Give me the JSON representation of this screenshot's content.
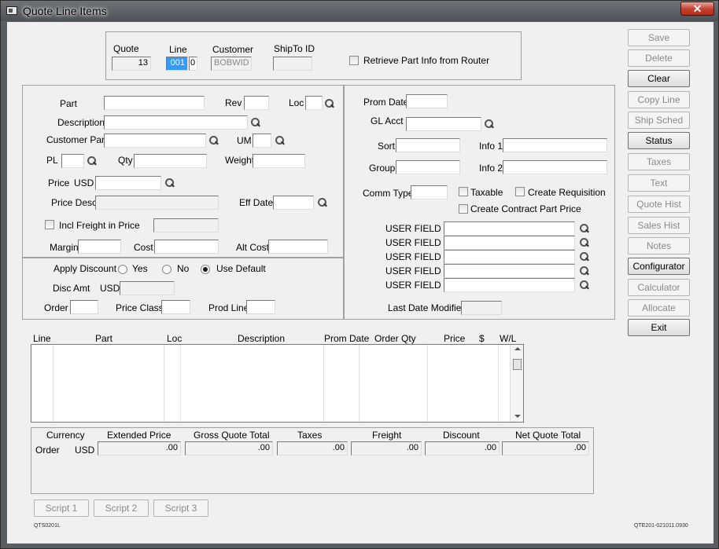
{
  "window": {
    "title": "Quote Line Items",
    "close_label": "✕"
  },
  "header": {
    "quote_label": "Quote",
    "quote_value": "13",
    "line_label": "Line",
    "line_value": "001",
    "line_sub_value": "0",
    "customer_label": "Customer",
    "customer_value": "BOBWID",
    "shipto_label": "ShipTo ID",
    "shipto_value": "",
    "retrieve_label": "Retrieve Part Info from Router"
  },
  "left": {
    "part_label": "Part",
    "rev_label": "Rev",
    "loc_label": "Loc",
    "description_label": "Description",
    "customer_part_label": "Customer Part",
    "um_label": "UM",
    "pl_label": "PL",
    "qty_label": "Qty",
    "weight_label": "Weight",
    "price_label": "Price",
    "price_currency": "USD",
    "price_desc_label": "Price Desc",
    "eff_date_label": "Eff Date",
    "incl_freight_label": "Incl Freight in Price",
    "margin_label": "Margin",
    "cost_label": "Cost",
    "alt_cost_label": "Alt Cost"
  },
  "discount": {
    "apply_label": "Apply Discount",
    "yes_label": "Yes",
    "no_label": "No",
    "default_label": "Use Default",
    "disc_amt_label": "Disc Amt",
    "disc_currency": "USD",
    "order_label": "Order",
    "price_class_label": "Price Class",
    "prod_line_label": "Prod Line"
  },
  "right": {
    "prom_date_label": "Prom Date",
    "gl_acct_label": "GL Acct",
    "sort_label": "Sort",
    "info1_label": "Info 1",
    "group_label": "Group",
    "info2_label": "Info 2",
    "comm_type_label": "Comm Type",
    "taxable_label": "Taxable",
    "create_req_label": "Create Requisition",
    "create_contract_label": "Create Contract Part Price",
    "user_fields": [
      "USER FIELD 1",
      "USER FIELD 2",
      "USER FIELD 3",
      "USER FIELD 4",
      "USER FIELD 5"
    ],
    "last_modified_label": "Last Date Modified"
  },
  "grid": {
    "columns": [
      "Line",
      "Part",
      "Loc",
      "Description",
      "Prom Date",
      "Order Qty",
      "Price",
      "$",
      "W/L"
    ]
  },
  "totals": {
    "currency_label": "Currency",
    "extended_label": "Extended Price",
    "gross_label": "Gross Quote Total",
    "taxes_label": "Taxes",
    "freight_label": "Freight",
    "discount_label": "Discount",
    "net_label": "Net Quote Total",
    "row_label": "Order",
    "row_currency": "USD",
    "extended_value": ".00",
    "gross_value": ".00",
    "taxes_value": ".00",
    "freight_value": ".00",
    "discount_value": ".00",
    "net_value": ".00"
  },
  "scripts": [
    "Script 1",
    "Script 2",
    "Script 3"
  ],
  "buttons": [
    {
      "label": "Save",
      "enabled": false
    },
    {
      "label": "Delete",
      "enabled": false
    },
    {
      "label": "Clear",
      "enabled": true
    },
    {
      "label": "Copy Line",
      "enabled": false
    },
    {
      "label": "Ship Sched",
      "enabled": false
    },
    {
      "label": "Status",
      "enabled": true
    },
    {
      "label": "Taxes",
      "enabled": false
    },
    {
      "label": "Text",
      "enabled": false
    },
    {
      "label": "Quote Hist",
      "enabled": false
    },
    {
      "label": "Sales Hist",
      "enabled": false
    },
    {
      "label": "Notes",
      "enabled": false
    },
    {
      "label": "Configurator",
      "enabled": true
    },
    {
      "label": "Calculator",
      "enabled": false
    },
    {
      "label": "Allocate",
      "enabled": false
    },
    {
      "label": "Exit",
      "enabled": true
    }
  ],
  "footer": {
    "left_code": "QTS0201L",
    "right_code": "QTE201-021011.0930"
  }
}
